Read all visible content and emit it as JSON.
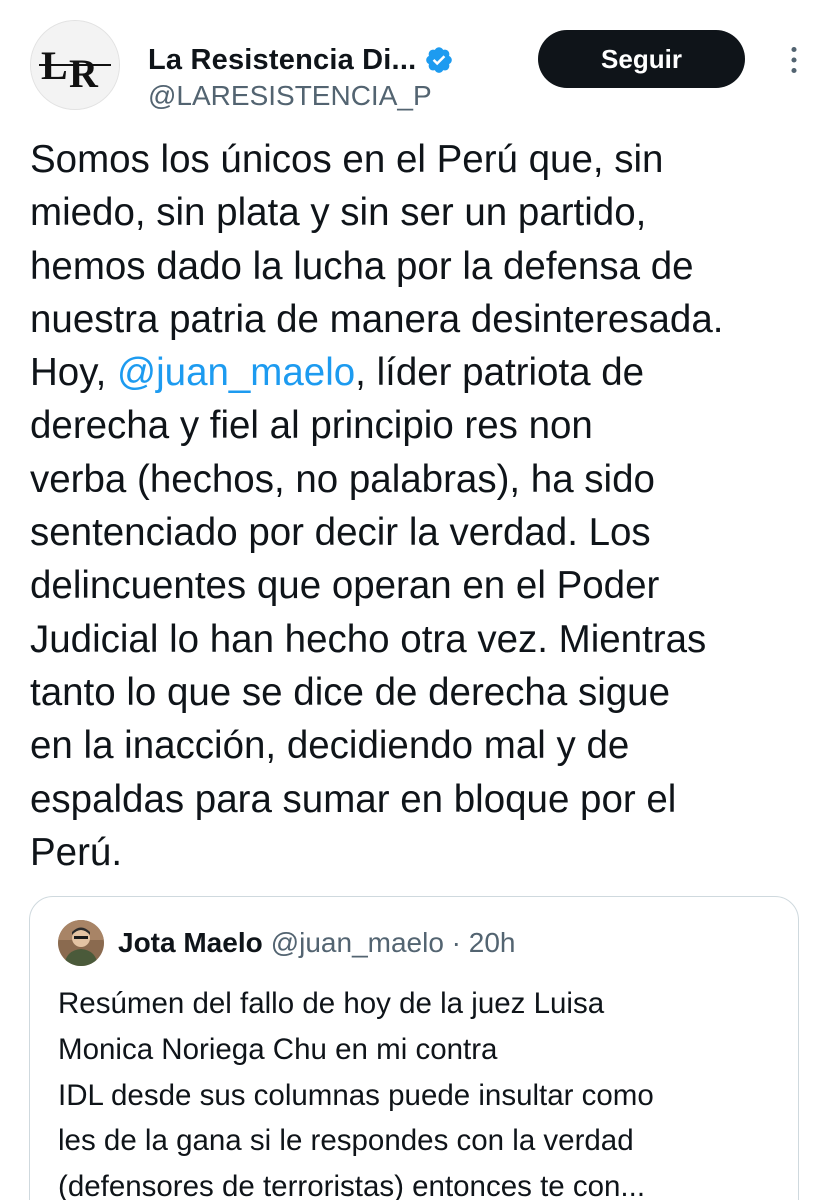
{
  "author": {
    "display_name": "La Resistencia Di...",
    "handle": "@LARESISTENCIA_P",
    "avatar_icon": "lr-logo",
    "verified_color": "#1d9bf0"
  },
  "actions": {
    "follow_label": "Seguir",
    "more_icon": "more-options-icon"
  },
  "tweet": {
    "lines": [
      "Somos los únicos en el Perú que, sin",
      "miedo, sin plata y sin ser un partido,",
      "hemos dado la lucha por la defensa de",
      "nuestra patria de manera desinteresada.",
      "Hoy, ",
      "@juan_maelo",
      ", líder patriota de",
      "derecha y fiel al principio res non",
      "verba (hechos, no palabras), ha sido",
      "sentenciado por decir la verdad. Los",
      "delincuentes que operan en el Poder",
      "Judicial lo han hecho otra vez. Mientras",
      "tanto lo que se dice de derecha sigue",
      "en la inacción, decidiendo mal y de",
      "espaldas para sumar en bloque por el",
      "Perú."
    ],
    "link_color": "#1d9bf0"
  },
  "quoted": {
    "name": "Jota Maelo",
    "meta": "@juan_maelo · 20h",
    "lines": [
      "Resúmen del fallo de hoy de la juez Luisa",
      "Monica Noriega Chu en mi contra",
      "IDL desde sus columnas puede insultar como",
      "les de la gana si le respondes con la verdad",
      "(defensores de terroristas)  entonces te con..."
    ]
  }
}
